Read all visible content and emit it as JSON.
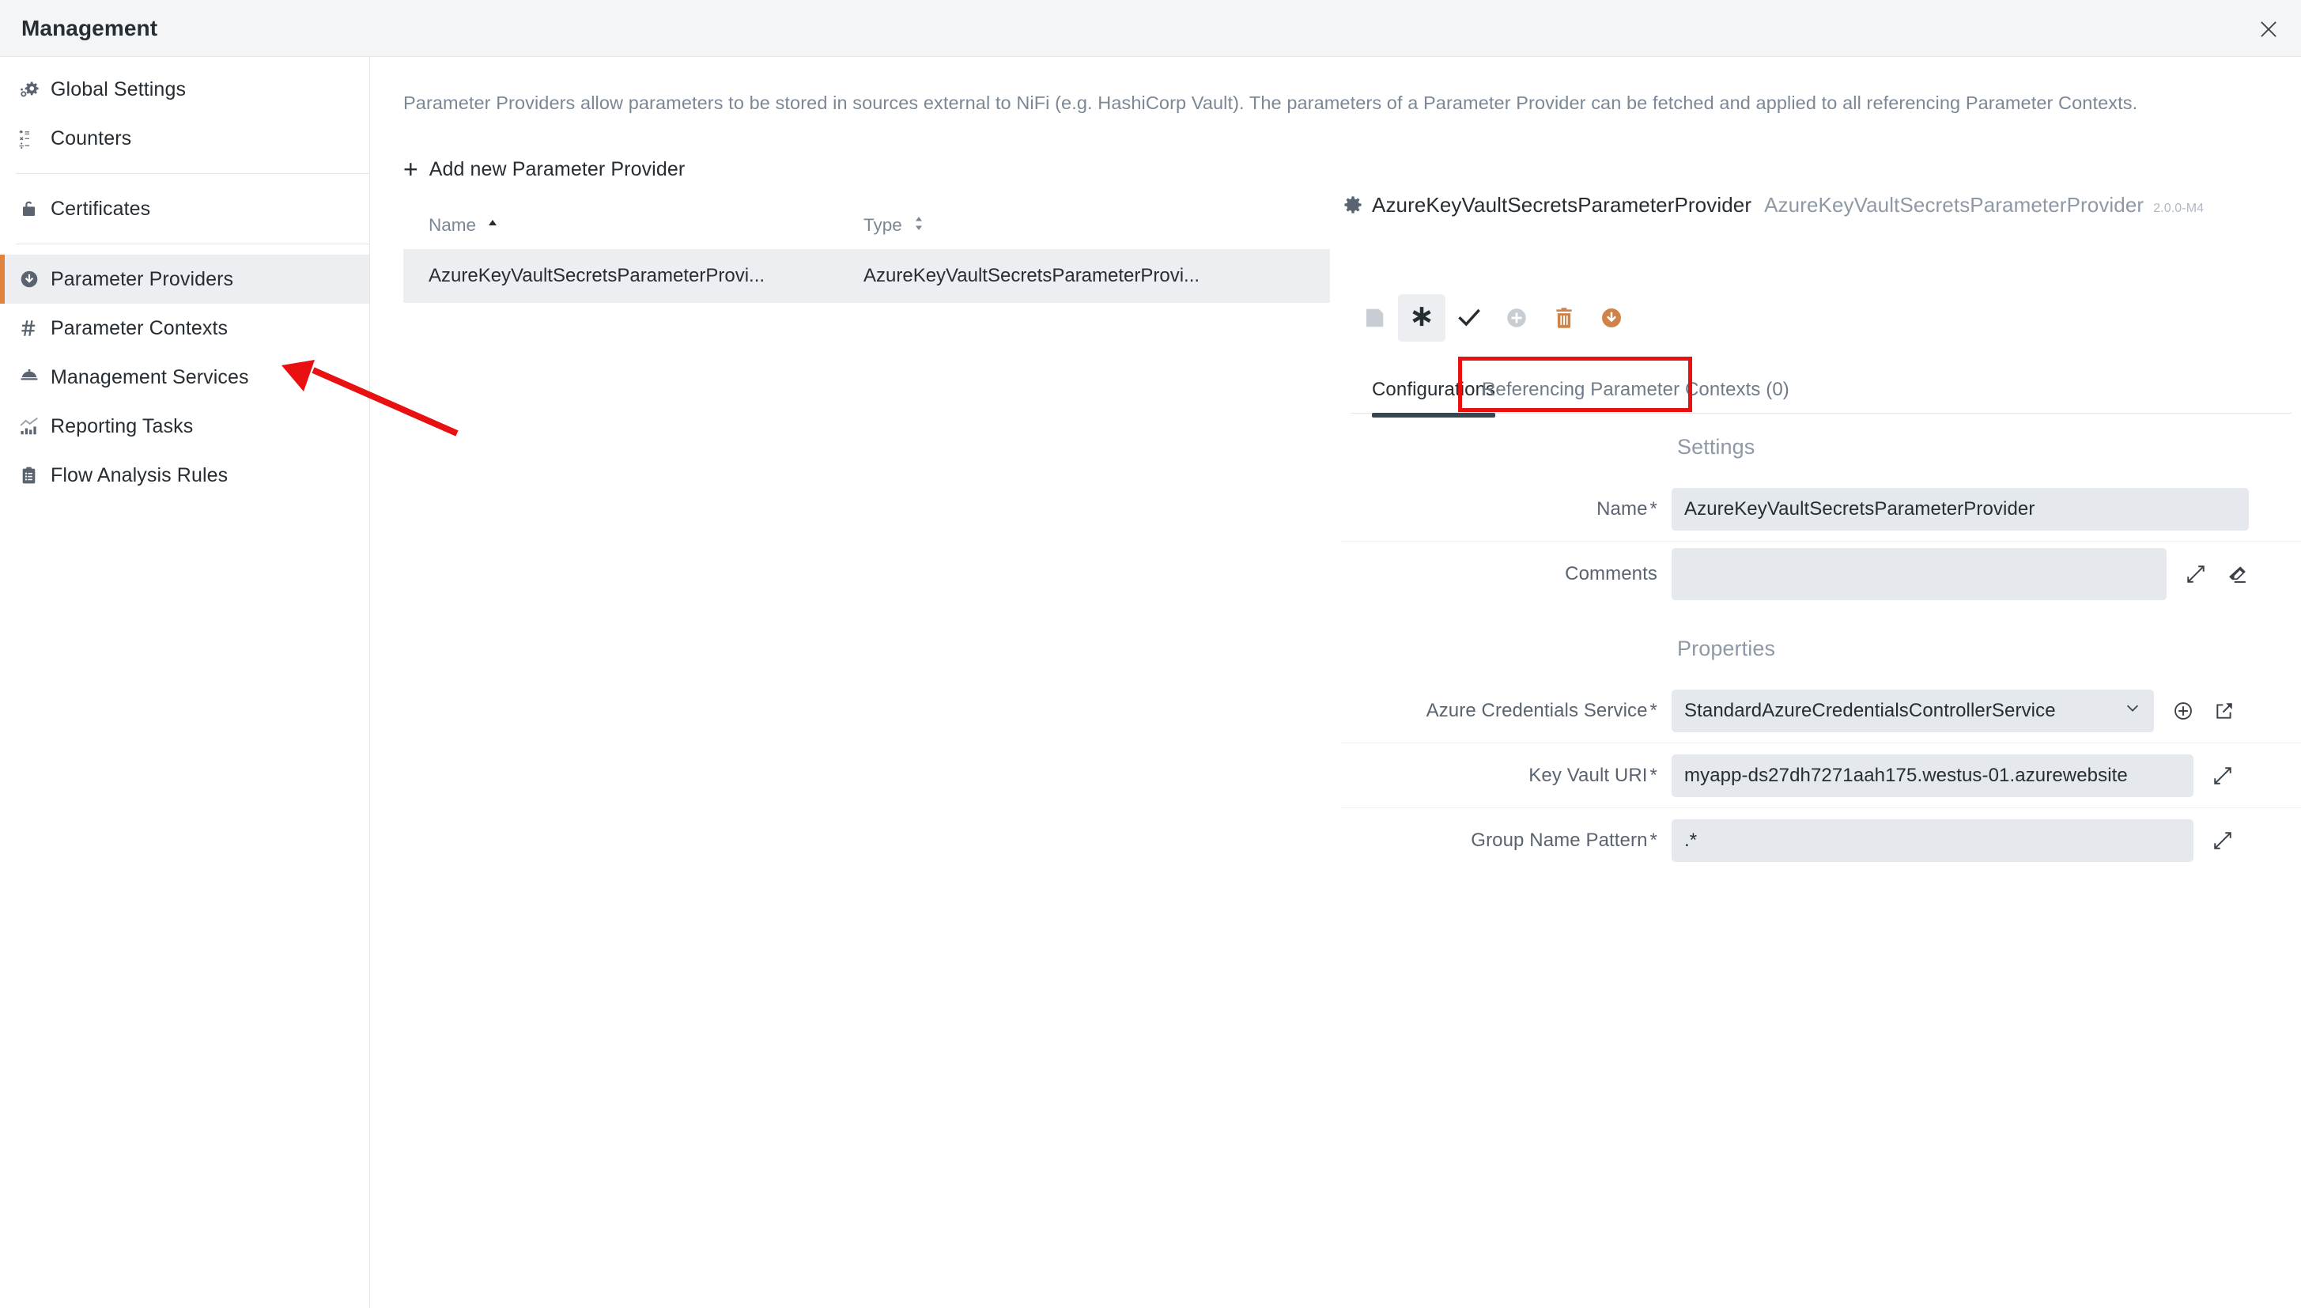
{
  "window": {
    "title": "Management",
    "close_icon": "close-icon"
  },
  "sidebar": {
    "groups": [
      {
        "items": [
          {
            "label": "Global Settings",
            "icon": "settings-gear-icon",
            "active": false
          },
          {
            "label": "Counters",
            "icon": "counters-icon",
            "active": false
          }
        ]
      },
      {
        "items": [
          {
            "label": "Certificates",
            "icon": "lock-icon",
            "active": false
          }
        ]
      },
      {
        "items": [
          {
            "label": "Parameter Providers",
            "icon": "download-circle-icon",
            "active": true
          },
          {
            "label": "Parameter Contexts",
            "icon": "hash-icon",
            "active": false
          },
          {
            "label": "Management Services",
            "icon": "service-bell-icon",
            "active": false
          },
          {
            "label": "Reporting Tasks",
            "icon": "chart-icon",
            "active": false
          },
          {
            "label": "Flow Analysis Rules",
            "icon": "clipboard-icon",
            "active": false
          }
        ]
      }
    ]
  },
  "main": {
    "description": "Parameter Providers allow parameters to be stored in sources external to NiFi (e.g. HashiCorp Vault). The parameters of a Parameter Provider can be fetched and applied to all referencing Parameter Contexts.",
    "add_button_label": "Add new Parameter Provider",
    "add_button_icon": "plus-icon",
    "table": {
      "columns": [
        {
          "label": "Name",
          "sort": "asc",
          "sort_icon": "sort-ascending-icon"
        },
        {
          "label": "Type",
          "sort": "none",
          "sort_icon": "sort-none-icon"
        }
      ],
      "rows": [
        {
          "name": "AzureKeyVaultSecretsParameterProvi...",
          "type": "AzureKeyVaultSecretsParameterProvi...",
          "selected": true
        }
      ]
    }
  },
  "detail": {
    "header": {
      "icon": "gear-icon",
      "name": "AzureKeyVaultSecretsParameterProvider",
      "type": "AzureKeyVaultSecretsParameterProvider",
      "version": "2.0.0-M4"
    },
    "toolbar": [
      {
        "name": "save-button",
        "icon": "save-disk-icon",
        "state": "disabled",
        "color": "#c8cdd3"
      },
      {
        "name": "configure-button",
        "icon": "asterisk-icon",
        "state": "selected",
        "color": "#262d33"
      },
      {
        "name": "apply-button",
        "icon": "check-icon",
        "state": "enabled",
        "color": "#262d33"
      },
      {
        "name": "add-button",
        "icon": "plus-circle-icon",
        "state": "disabled",
        "color": "#c8cdd3"
      },
      {
        "name": "delete-button",
        "icon": "trash-icon",
        "state": "enabled",
        "color": "#d08349"
      },
      {
        "name": "fetch-button",
        "icon": "download-circle-icon",
        "state": "enabled",
        "color": "#d08349"
      }
    ],
    "tabs": [
      {
        "label": "Configurations",
        "active": true
      },
      {
        "label": "Referencing Parameter Contexts (0)",
        "active": false,
        "highlighted": true
      }
    ],
    "settings": {
      "section_title": "Settings",
      "fields": [
        {
          "label": "Name",
          "required": true,
          "value": "AzureKeyVaultSecretsParameterProvider",
          "placeholder": "",
          "control": "text",
          "icons": []
        },
        {
          "label": "Comments",
          "required": false,
          "value": "",
          "placeholder": "",
          "control": "textarea",
          "icons": [
            "expand-icon",
            "eraser-icon"
          ]
        }
      ]
    },
    "properties": {
      "section_title": "Properties",
      "fields": [
        {
          "label": "Azure Credentials Service",
          "required": true,
          "value": "StandardAzureCredentialsControllerService",
          "placeholder": "",
          "control": "select",
          "dropdown_icon": "chevron-down-icon",
          "icons": [
            "plus-circle-outline-icon",
            "external-link-icon"
          ]
        },
        {
          "label": "Key Vault URI",
          "required": true,
          "value": "myapp-ds27dh7271aah175.westus-01.azurewebsite",
          "placeholder": "",
          "control": "text",
          "icons": [
            "expand-icon"
          ]
        },
        {
          "label": "Group Name Pattern",
          "required": true,
          "value": ".*",
          "placeholder": "",
          "control": "text",
          "icons": [
            "expand-icon"
          ]
        }
      ]
    }
  },
  "annotations": {
    "arrow": {
      "color": "#e81010",
      "points_to": "Management Services"
    },
    "box": {
      "color": "#e81010",
      "around": "Referencing Parameter Contexts (0)"
    }
  },
  "colors": {
    "accent": "#e0833c",
    "annotation": "#e81010",
    "text": "#262d33",
    "muted": "#7b8794",
    "field_bg": "#e5e8ec",
    "row_selected": "#eceef1"
  }
}
